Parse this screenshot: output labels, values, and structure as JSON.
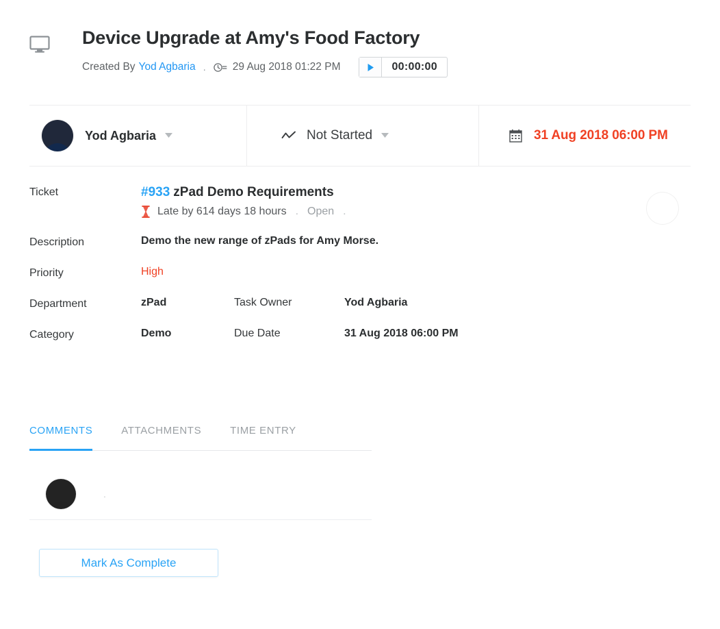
{
  "header": {
    "icon": "monitor-icon",
    "title": "Device Upgrade at Amy's Food Factory",
    "created_label": "Created By",
    "creator": "Yod Agbaria",
    "separator_dot": ".",
    "clock_icon": "clock-list-icon",
    "created_date": "29 Aug 2018 01:22 PM",
    "timer": {
      "play_icon": "play-icon",
      "value": "00:00:00"
    }
  },
  "status_bar": {
    "owner": {
      "avatar": "avatar-yod-agbaria",
      "name": "Yod Agbaria",
      "caret": "▾"
    },
    "state": {
      "icon": "trend-line-icon",
      "label": "Not Started",
      "caret": "▾"
    },
    "due": {
      "icon": "calendar-icon",
      "date": "31 Aug 2018 06:00 PM"
    }
  },
  "details": {
    "ticket_label": "Ticket",
    "ticket_number": "#933",
    "ticket_title": "zPad Demo Requirements",
    "late_icon": "hourglass-icon",
    "late_text": "Late by 614 days 18 hours",
    "dot1": ".",
    "open_status": "Open",
    "dot2": ".",
    "avatar": "avatar-requester",
    "description_label": "Description",
    "description_value": "Demo the new range of zPads for Amy Morse.",
    "priority_label": "Priority",
    "priority_value": "High",
    "department_label": "Department",
    "department_value": "zPad",
    "task_owner_label": "Task Owner",
    "task_owner_value": "Yod Agbaria",
    "category_label": "Category",
    "category_value": "Demo",
    "due_date_label": "Due Date",
    "due_date_value": "31 Aug 2018 06:00 PM"
  },
  "tabs": [
    {
      "label": "COMMENTS",
      "active": true
    },
    {
      "label": "ATTACHMENTS",
      "active": false
    },
    {
      "label": "TIME ENTRY",
      "active": false
    }
  ],
  "comment": {
    "avatar": "avatar-commenter",
    "dot": "."
  },
  "footer": {
    "complete_label": "Mark As Complete"
  },
  "colors": {
    "link_blue": "#29a3f5",
    "accent_blue": "#2196f3",
    "alert_red": "#f04124",
    "text_dark": "#2b2e30",
    "text_muted": "#9ba0a4"
  }
}
